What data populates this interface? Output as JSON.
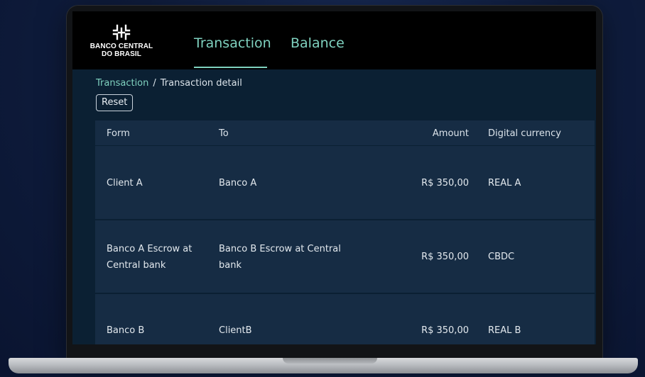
{
  "header": {
    "logo_line1": "BANCO CENTRAL",
    "logo_line2": "DO BRASIL",
    "tabs": [
      {
        "label": "Transaction",
        "active": true
      },
      {
        "label": "Balance",
        "active": false
      }
    ]
  },
  "breadcrumb": {
    "parent": "Transaction",
    "separator": "/",
    "current": "Transaction detail"
  },
  "reset_label": "Reset",
  "table": {
    "headers": [
      "Form",
      "To",
      "Amount",
      "Digital currency"
    ],
    "rows": [
      [
        "Client A",
        "Banco A",
        "R$ 350,00",
        "REAL A"
      ],
      [
        "Banco A Escrow at Central bank",
        "Banco B Escrow at Central bank",
        "R$ 350,00",
        "CBDC"
      ],
      [
        "Banco B",
        "ClientB",
        "R$ 350,00",
        "REAL B"
      ]
    ]
  },
  "colors": {
    "accent": "#7fd1bf",
    "content_bg": "#0b2033",
    "table_bg": "#162c44",
    "page_bg": "#0f1d3e"
  },
  "icons": {
    "logo": "bcb-emblem-icon"
  }
}
